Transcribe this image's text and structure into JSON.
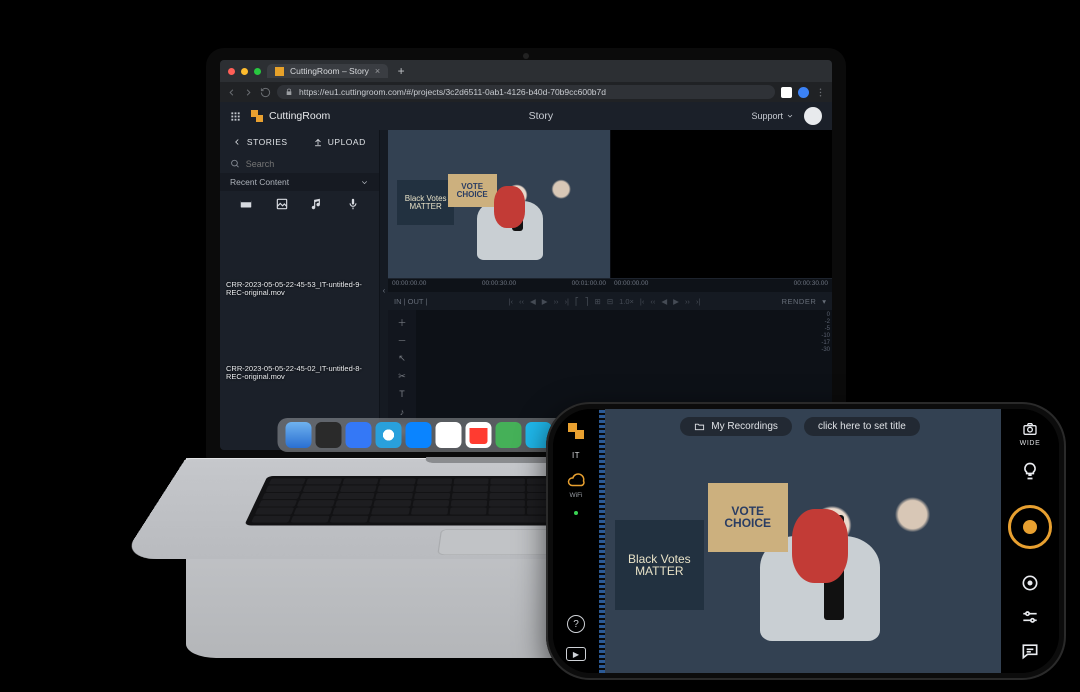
{
  "browser": {
    "tab_title": "CuttingRoom – Story",
    "url": "https://eu1.cuttingroom.com/#/projects/3c2d6511-0ab1-4126-b40d-70b9cc600b7d",
    "traffic_colors": [
      "#ff5f57",
      "#febc2e",
      "#28c840"
    ],
    "ext_colors": [
      "#3b82f6"
    ]
  },
  "app": {
    "brand": "CuttingRoom",
    "title": "Story",
    "support": "Support"
  },
  "sidebar": {
    "tab_stories": "STORIES",
    "tab_upload": "UPLOAD",
    "search_placeholder": "Search",
    "recent_label": "Recent Content",
    "clips": [
      {
        "caption": "CRR-2023-05-05-22-45-53_IT-untitled-9-REC-original.mov",
        "kind": "protest"
      },
      {
        "caption": "CRR-2023-05-05-22-45-02_IT-untitled-8-REC-original.mov",
        "kind": "dock"
      },
      {
        "caption": "",
        "kind": "dock"
      }
    ],
    "signs": {
      "a": "Black Votes MATTER",
      "b": "VOTE CHOICE"
    }
  },
  "timeline": {
    "left_marks": [
      "00:00:00.00",
      "00:00:30.00",
      "00:01:00.00"
    ],
    "right_marks": [
      "00:00:00.00",
      "00:00:30.00"
    ],
    "label_in": "IN ",
    "label_out": "OUT ",
    "speed": "1.0×",
    "render": "RENDER",
    "db_scale": [
      "0",
      "-2",
      "-5",
      "-10",
      "-17",
      "-30"
    ]
  },
  "dock_colors": [
    "#5ea0e3",
    "#2a2a2a",
    "#3478f6",
    "#29a0dc",
    "#0a84ff",
    "#ffffff",
    "#ff3b30",
    "#45b058",
    "#1fb7ea",
    "#ffb400",
    "#34c759",
    "#4a90d9",
    "#ff9500",
    "#ff2d55",
    "#e23c2e",
    "#c1c1c5"
  ],
  "phone": {
    "user": "IT",
    "wifi": "WiFi",
    "chip_recordings": "My Recordings",
    "chip_title": "click here to set title",
    "cam_label": "WIDE",
    "signs": {
      "a": "Black Votes MATTER",
      "b": "VOTE CHOICE"
    }
  }
}
